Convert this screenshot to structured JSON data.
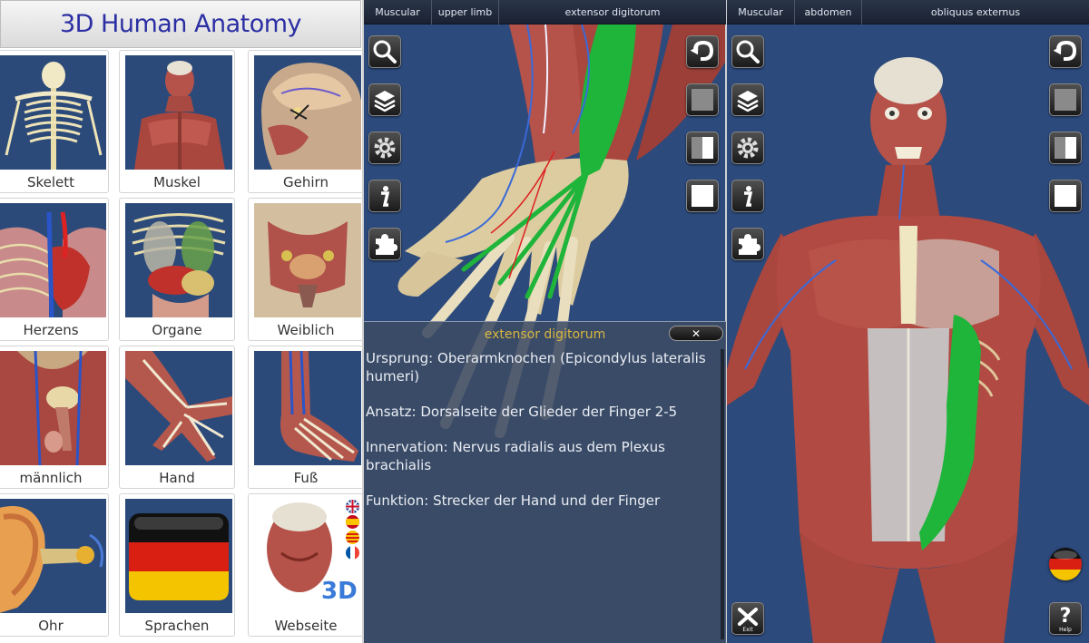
{
  "app": {
    "title": "3D Human Anatomy"
  },
  "menu": {
    "tiles": [
      {
        "label": "Skelett",
        "icon": "skeleton-thumbnail"
      },
      {
        "label": "Muskel",
        "icon": "muscle-thumbnail"
      },
      {
        "label": "Gehirn",
        "icon": "brain-thumbnail"
      },
      {
        "label": "Herzens",
        "icon": "heart-thumbnail"
      },
      {
        "label": "Organe",
        "icon": "organs-thumbnail"
      },
      {
        "label": "Weiblich",
        "icon": "female-pelvis-thumbnail"
      },
      {
        "label": "männlich",
        "icon": "male-pelvis-thumbnail"
      },
      {
        "label": "Hand",
        "icon": "hand-thumbnail"
      },
      {
        "label": "Fuß",
        "icon": "foot-thumbnail"
      },
      {
        "label": "Ohr",
        "icon": "ear-thumbnail"
      },
      {
        "label": "Sprachen",
        "icon": "german-flag-thumbnail"
      },
      {
        "label": "Webseite",
        "icon": "website-3d-thumbnail"
      }
    ],
    "language_flags": [
      "uk-flag-icon",
      "spain-flag-icon",
      "catalan-flag-icon",
      "france-flag-icon"
    ]
  },
  "viewer_hand": {
    "breadcrumb": [
      "Muscular",
      "upper limb",
      "extensor digitorum"
    ],
    "info": {
      "title": "extensor digitorum",
      "close_symbol": "✕",
      "paragraphs": [
        "Ursprung: Oberarmknochen (Epicondylus lateralis humeri)",
        "Ansatz: Dorsalseite der Glieder der Finger 2-5",
        "Innervation: Nervus radialis aus dem Plexus brachialis",
        "Funktion: Strecker der Hand und der Finger"
      ]
    }
  },
  "viewer_torso": {
    "breadcrumb": [
      "Muscular",
      "abdomen",
      "obliquus externus"
    ],
    "exit_label": "Exit",
    "help_label": "Help",
    "help_symbol": "?",
    "info_symbol": "i"
  },
  "colors": {
    "background_blue": "#2c4a7c",
    "highlight_green": "#1fb43a",
    "title_blue": "#2b2fa3",
    "info_title_gold": "#d8b640"
  }
}
